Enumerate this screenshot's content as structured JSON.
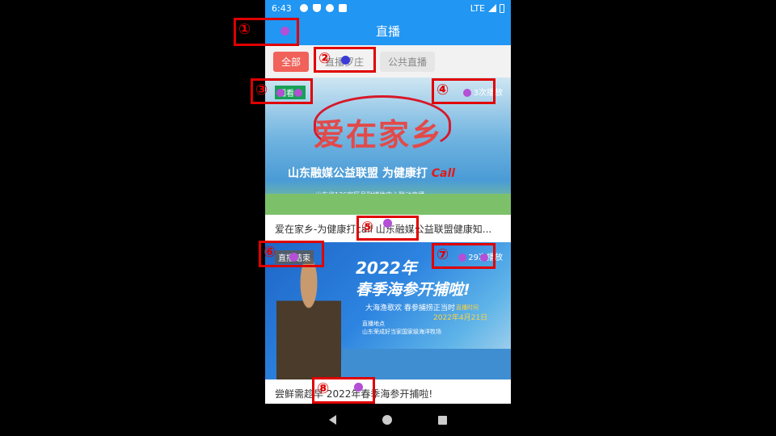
{
  "status": {
    "time": "6:43",
    "network": "LTE"
  },
  "header": {
    "title": "直播"
  },
  "filters": [
    {
      "label": "全部"
    },
    {
      "label": "直播罗庄"
    },
    {
      "label": "公共直播"
    }
  ],
  "cards": [
    {
      "state": "回看中",
      "views": "3次播放",
      "title": "爱在家乡-为健康打call 山东融媒公益联盟健康知...",
      "image_text": {
        "headline": "爱在家乡",
        "subline": "山东融媒公益联盟  为健康打",
        "call": "Call",
        "note": "山东省136家区县融媒体中心联动直播"
      }
    },
    {
      "state": "直播结束",
      "views": "29次播放",
      "title": "尝鲜需趁早 2022年春季海参开捕啦!",
      "image_text": {
        "year": "2022年",
        "headline": "春季海参开捕啦!",
        "slogan": "大海渔歌欢 春参捕捞正当时",
        "date_label": "直播时间",
        "date": "2022年4月21日",
        "loc_label": "直播地点",
        "loc": "山东荣成好当家国家级海洋牧场"
      }
    }
  ],
  "markers": [
    {
      "num": "①"
    },
    {
      "num": "②"
    },
    {
      "num": "③"
    },
    {
      "num": "④"
    },
    {
      "num": "⑤"
    },
    {
      "num": "⑥"
    },
    {
      "num": "⑦"
    },
    {
      "num": "⑧"
    }
  ],
  "colors": {
    "app_bar": "#2196f3",
    "chip_active": "#f0625a",
    "marker": "#e00000",
    "dot_purple": "#b44fd6",
    "dot_blue": "#3a3ad6"
  }
}
